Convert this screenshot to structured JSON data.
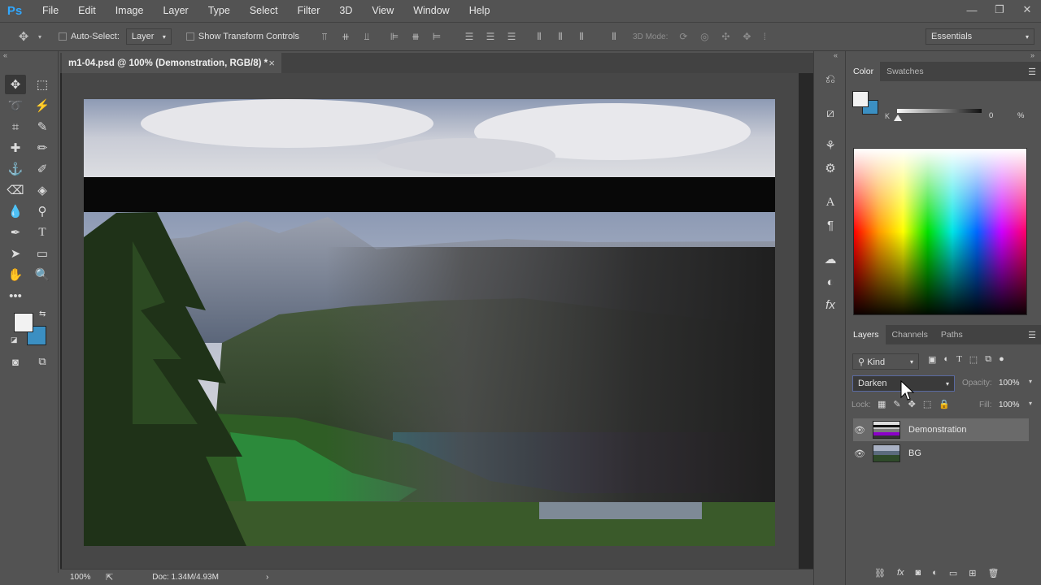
{
  "app": {
    "logo": "Ps"
  },
  "menu": [
    "File",
    "Edit",
    "Image",
    "Layer",
    "Type",
    "Select",
    "Filter",
    "3D",
    "View",
    "Window",
    "Help"
  ],
  "window_controls": {
    "minimize": "—",
    "restore": "❐",
    "close": "✕"
  },
  "options": {
    "auto_select_label": "Auto-Select:",
    "auto_select_value": "Layer",
    "transform_label": "Show Transform Controls",
    "mode3d_label": "3D Mode:",
    "workspace": "Essentials"
  },
  "document": {
    "tab_title": "m1-04.psd @ 100% (Demonstration, RGB/8) *",
    "close": "×"
  },
  "status": {
    "zoom": "100%",
    "doc_info": "Doc: 1.34M/4.93M"
  },
  "color_panel": {
    "tabs": [
      "Color",
      "Swatches"
    ],
    "slider_label": "K",
    "slider_value": "0",
    "slider_unit": "%"
  },
  "layers_panel": {
    "tabs": [
      "Layers",
      "Channels",
      "Paths"
    ],
    "filter_label": "Kind",
    "blend_mode": "Darken",
    "opacity_label": "Opacity:",
    "opacity_value": "100%",
    "lock_label": "Lock:",
    "fill_label": "Fill:",
    "fill_value": "100%",
    "layers": [
      {
        "name": "Demonstration",
        "selected": true
      },
      {
        "name": "BG",
        "selected": false
      }
    ]
  },
  "colors": {
    "foreground": "#f2f2f2",
    "background": "#3b8fc2",
    "accent": "#31a8ff"
  }
}
